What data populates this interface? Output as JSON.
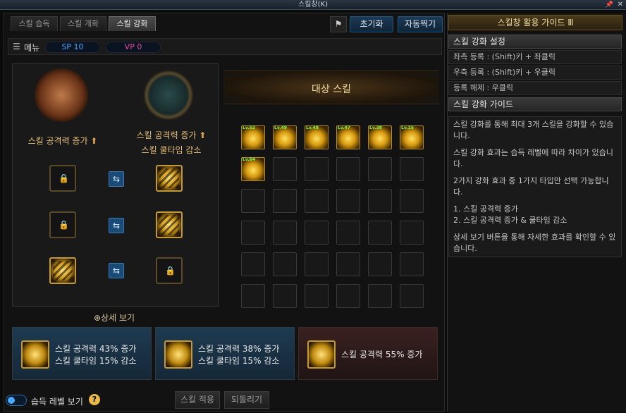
{
  "window": {
    "title": "스킬창(K)"
  },
  "tabs": [
    "스킬 습득",
    "스킬 개화",
    "스킬 강화"
  ],
  "toolbar": {
    "reset": "초기화",
    "auto": "자동찍기"
  },
  "menu": {
    "label": "메뉴",
    "sp": "SP 10",
    "vp": "VP 0"
  },
  "enhance": {
    "option1": "스킬 공격력 증가",
    "option2_line1": "스킬 공격력 증가",
    "option2_line2": "스킬 쿨타임 감소",
    "detail": "상세 보기"
  },
  "target": {
    "title": "대상 스킬",
    "levels": [
      "Lv.52",
      "Lv.49",
      "Lv.48",
      "Lv.47",
      "Lv.38",
      "Lv.15",
      "Lv.64"
    ]
  },
  "cards": [
    {
      "line1": "스킬 공격력 43% 증가",
      "line2": "스킬 쿨타임 15% 감소"
    },
    {
      "line1": "스킬 공격력 38% 증가",
      "line2": "스킬 쿨타임 15% 감소"
    },
    {
      "line1": "스킬 공격력 55% 증가",
      "line2": ""
    }
  ],
  "bottom": {
    "toggle_label": "습득 레벨 보기",
    "apply": "스킬 적용",
    "revert": "되돌리기"
  },
  "guide": {
    "title": "스킬창 활용 가이드 Ⅲ",
    "setup_title": "스킬 강화 설정",
    "setup_rows": [
      "좌측 등록 : (Shift)키 + 좌클릭",
      "우측 등록 : (Shift)키 + 우클릭",
      "등록 해제 : 우클릭"
    ],
    "guide_title": "스킬 강화 가이드",
    "paragraphs": [
      "스킬 강화를 통해 최대 3개 스킬을 강화할 수 있습니다.",
      "스킬 강화 효과는 습득 레벨에 따라 차이가 있습니다.",
      "2가지 강화 효과 중 1가지 타입만 선택 가능합니다.",
      "1. 스킬 공격력 증가\n2. 스킬 공격력 증가 & 쿨타임 감소",
      "상세 보기 버튼을 통해 자세한 효과를 확인할 수 있습니다."
    ]
  },
  "colors": {
    "accent_gold": "#e8c27a",
    "accent_blue": "#4aa8ff"
  }
}
